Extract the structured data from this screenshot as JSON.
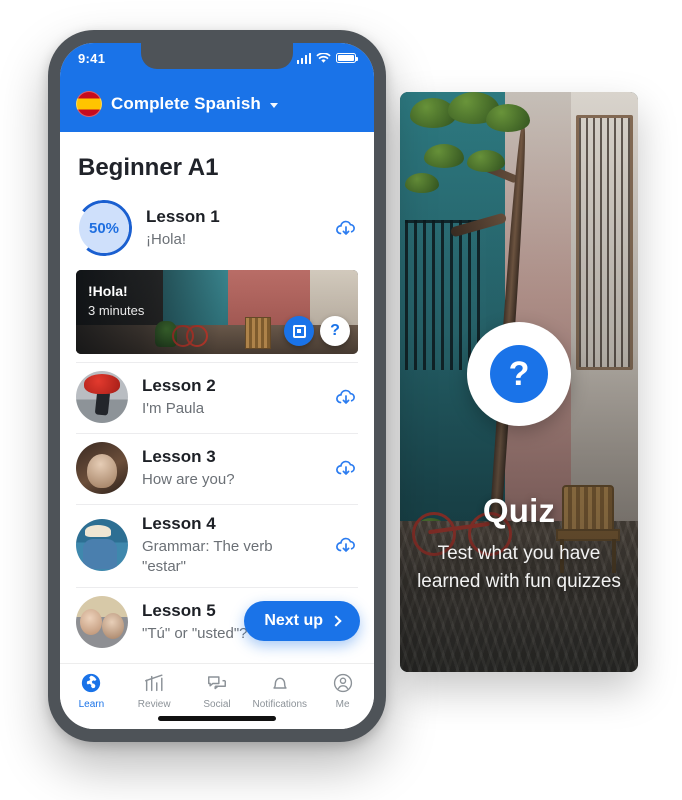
{
  "phone": {
    "status_bar": {
      "time": "9:41",
      "icons": [
        "cellular-signal-icon",
        "wifi-icon",
        "battery-icon"
      ]
    },
    "app_bar": {
      "flag_icon": "spanish-flag-icon",
      "title": "Complete Spanish",
      "chevron_icon": "chevron-down-icon"
    },
    "page_title": "Beginner A1",
    "lessons": [
      {
        "name": "Lesson 1",
        "desc": "¡Hola!",
        "progress_label": "50%",
        "progress_value": 50,
        "thumb": "progress-ring",
        "download_icon": "cloud-download-icon"
      },
      {
        "name": "Lesson 2",
        "desc": "I'm Paula",
        "thumb": "avatar-red-umbrella",
        "download_icon": "cloud-download-icon"
      },
      {
        "name": "Lesson 3",
        "desc": "How are you?",
        "thumb": "avatar-couple-hug",
        "download_icon": "cloud-download-icon"
      },
      {
        "name": "Lesson 4",
        "desc": "Grammar: The verb \"estar\"",
        "thumb": "avatar-man-hat",
        "download_icon": "cloud-download-icon"
      },
      {
        "name": "Lesson 5",
        "desc": "\"Tú\" or \"usted\"?",
        "thumb": "avatar-two-men",
        "download_icon": "cloud-download-icon"
      }
    ],
    "video_card": {
      "title": "!Hola!",
      "duration": "3 minutes",
      "buttons": [
        {
          "icon": "flashcard-icon",
          "style": "blue"
        },
        {
          "icon": "question-mark-icon",
          "style": "white"
        }
      ]
    },
    "next_up_button": {
      "label": "Next up",
      "chevron_icon": "chevron-right-icon"
    },
    "tab_bar": [
      {
        "label": "Learn",
        "icon": "globe-icon",
        "active": true
      },
      {
        "label": "Review",
        "icon": "bar-chart-icon",
        "active": false
      },
      {
        "label": "Social",
        "icon": "chat-bubbles-icon",
        "active": false
      },
      {
        "label": "Notifications",
        "icon": "bell-icon",
        "active": false
      },
      {
        "label": "Me",
        "icon": "person-circle-icon",
        "active": false
      }
    ]
  },
  "quiz_panel": {
    "badge_icon": "question-mark-icon",
    "title": "Quiz",
    "subtitle": "Test what you have learned with fun quizzes"
  },
  "colors": {
    "accent_blue": "#1a73e8",
    "phone_frame": "#4e5358",
    "text_primary": "#1d2026",
    "text_secondary": "#6b7076"
  }
}
